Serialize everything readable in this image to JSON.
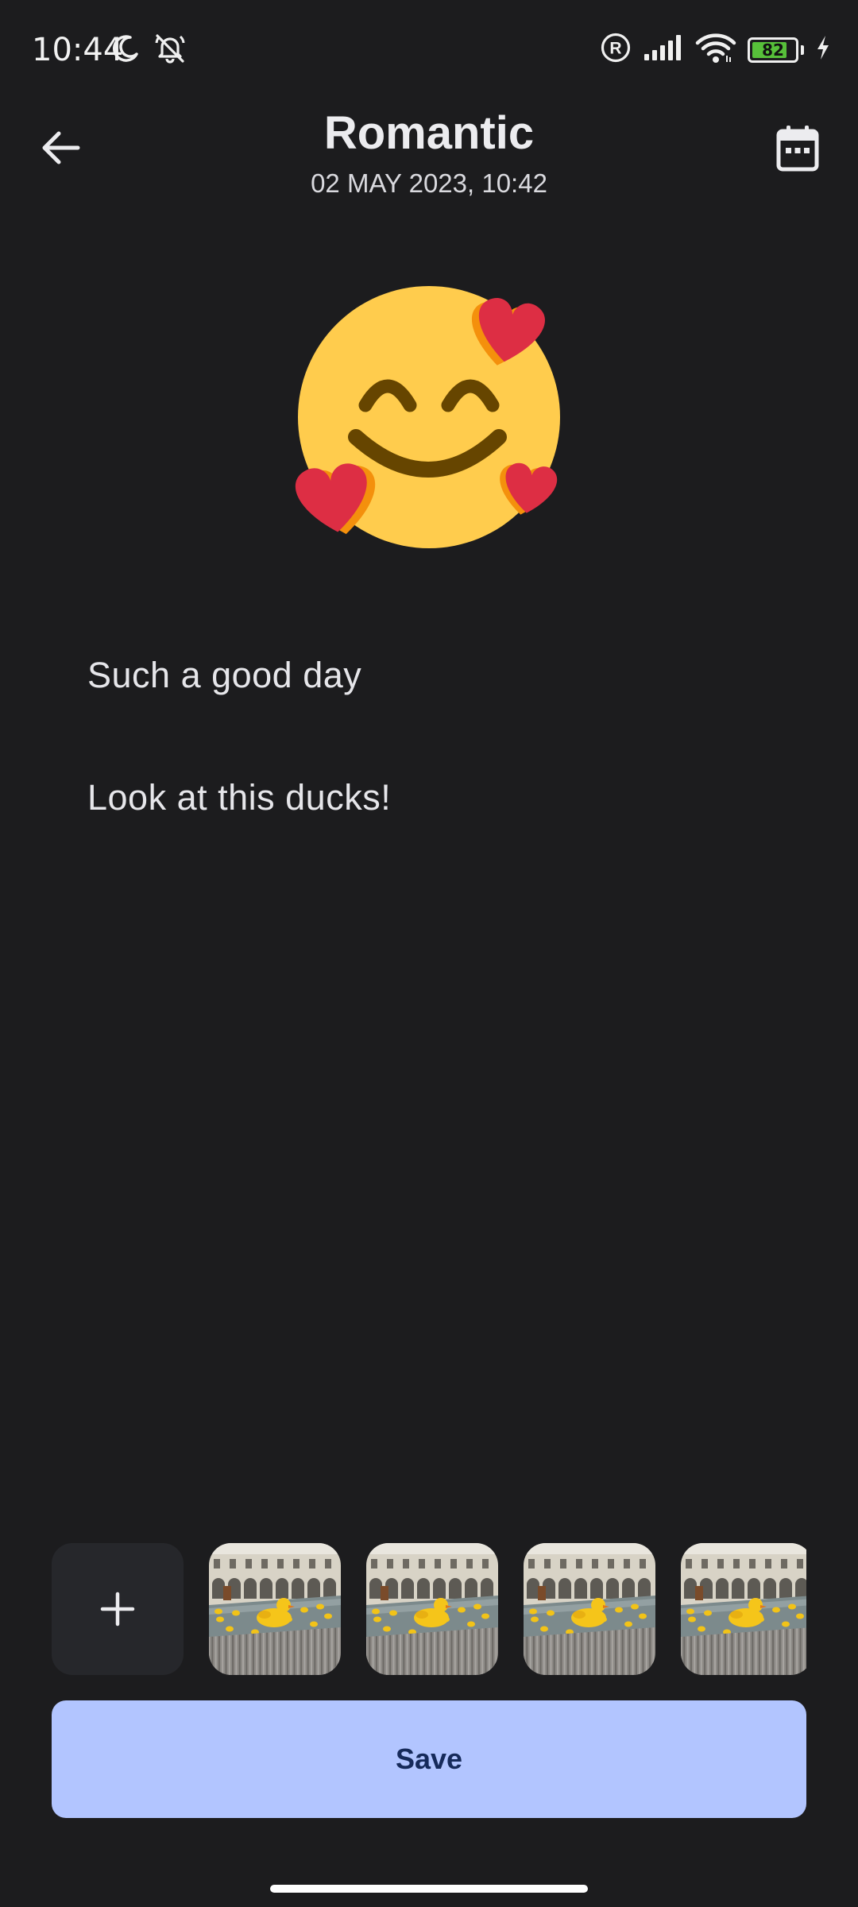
{
  "status_bar": {
    "time": "10:44",
    "battery_level": "82",
    "battery_fraction": 0.82,
    "icons": [
      "moon-icon",
      "bell-off-icon",
      "registered-icon",
      "signal-icon",
      "wifi-icon",
      "battery-icon",
      "charging-icon"
    ]
  },
  "header": {
    "title": "Romantic",
    "subtitle": "02 MAY 2023, 10:42",
    "back_icon": "arrow-left-icon",
    "calendar_icon": "calendar-icon"
  },
  "mood": {
    "icon": "smiling-face-with-hearts-icon",
    "colors": {
      "face": "#ffcc4d",
      "features": "#664500",
      "heart": "#dd2e44",
      "heart_shadow": "#f4900c"
    }
  },
  "notes": [
    {
      "text": "Such a good day"
    },
    {
      "text": "Look at this ducks!"
    }
  ],
  "photos": {
    "add_icon": "plus-icon",
    "thumbnails": [
      {
        "description": "ducks-fountain-photo"
      },
      {
        "description": "ducks-fountain-photo"
      },
      {
        "description": "ducks-fountain-photo"
      },
      {
        "description": "ducks-fountain-photo"
      }
    ]
  },
  "actions": {
    "save_label": "Save"
  },
  "colors": {
    "background": "#1c1c1e",
    "primary_button": "#b2c5ff",
    "primary_button_text": "#162a5a",
    "add_button": "#26272b"
  }
}
